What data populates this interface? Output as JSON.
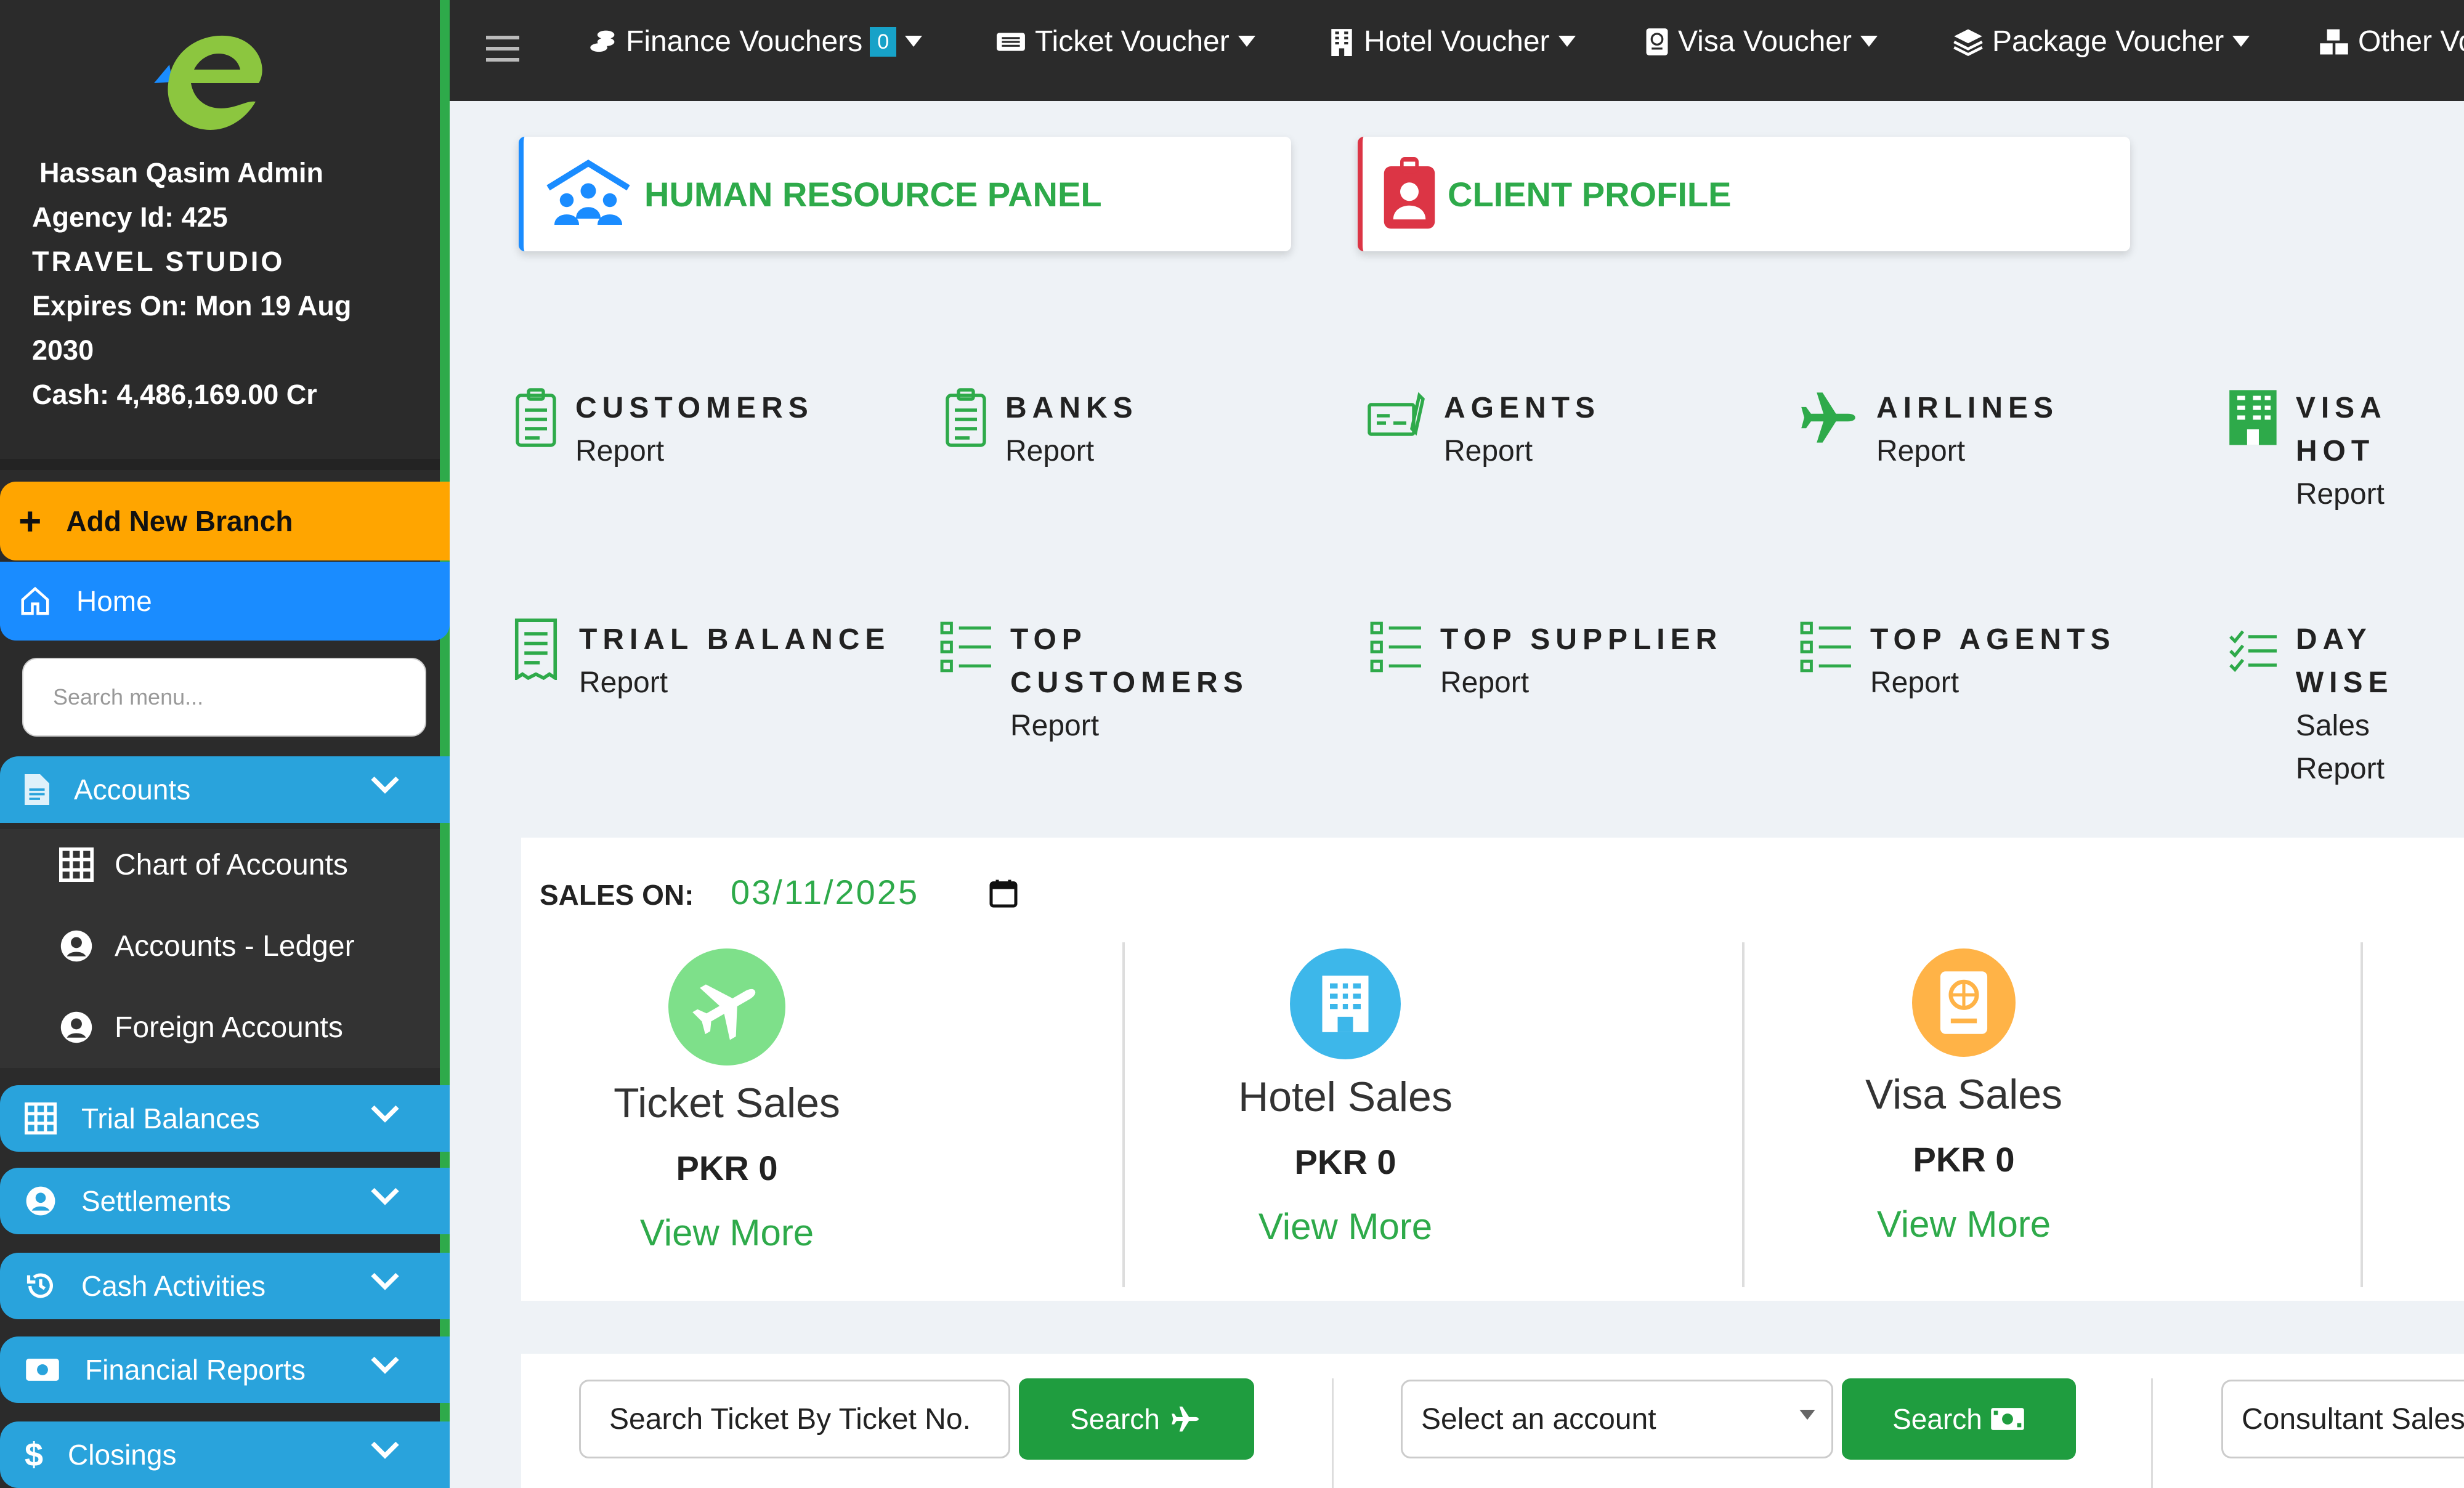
{
  "profile": {
    "name": "Hassan Qasim Admin",
    "agency_id": "Agency Id: 425",
    "agency_name": "TRAVEL STUDIO",
    "expires_line1": "Expires On: Mon 19 Aug",
    "expires_line2": "2030",
    "cash": "Cash: 4,486,169.00 Cr"
  },
  "sidebar": {
    "add_branch": "Add New Branch",
    "home": "Home",
    "search_placeholder": "Search menu...",
    "accounts": "Accounts",
    "sub_items": [
      "Chart of Accounts",
      "Accounts - Ledger",
      "Foreign Accounts"
    ],
    "groups": [
      "Trial Balances",
      "Settlements",
      "Cash Activities",
      "Financial Reports",
      "Closings"
    ]
  },
  "topbar": {
    "items": [
      "Finance Vouchers",
      "Ticket Voucher",
      "Hotel Voucher",
      "Visa Voucher",
      "Package Voucher",
      "Other Vo"
    ],
    "finance_badge": "0"
  },
  "panels": {
    "hr": "HUMAN RESOURCE PANEL",
    "client": "CLIENT PROFILE"
  },
  "reports_row1": [
    {
      "title": "CUSTOMERS",
      "sub": "Report"
    },
    {
      "title": "BANKS",
      "sub": "Report"
    },
    {
      "title": "AGENTS",
      "sub": "Report"
    },
    {
      "title": "AIRLINES",
      "sub": "Report"
    },
    {
      "title": "VISA HOT",
      "sub": "Report"
    }
  ],
  "reports_row2": [
    {
      "title": "TRIAL BALANCE",
      "sub": "Report"
    },
    {
      "title": "TOP",
      "title2": "CUSTOMERS",
      "sub": "Report"
    },
    {
      "title": "TOP SUPPLIER",
      "sub": "Report"
    },
    {
      "title": "TOP AGENTS",
      "sub": "Report"
    },
    {
      "title": "DAY WISE",
      "sub": "Sales Report"
    }
  ],
  "sales": {
    "label": "SALES ON:",
    "date": "03/11/2025",
    "cards": [
      {
        "title": "Ticket Sales",
        "amount": "PKR 0",
        "more": "View More",
        "color": "#7ee08a"
      },
      {
        "title": "Hotel Sales",
        "amount": "PKR 0",
        "more": "View More",
        "color": "#3db7ea"
      },
      {
        "title": "Visa Sales",
        "amount": "PKR 0",
        "more": "View More",
        "color": "#ffb347"
      }
    ]
  },
  "search_row": {
    "ticket_placeholder": "Search Ticket By Ticket No.",
    "search_label": "Search",
    "account_select": "Select an account",
    "consultant": "Consultant Sales"
  },
  "colors": {
    "accent_green": "#2eaa4a",
    "accent_blue": "#29a3dc",
    "orange": "#ffa500"
  }
}
